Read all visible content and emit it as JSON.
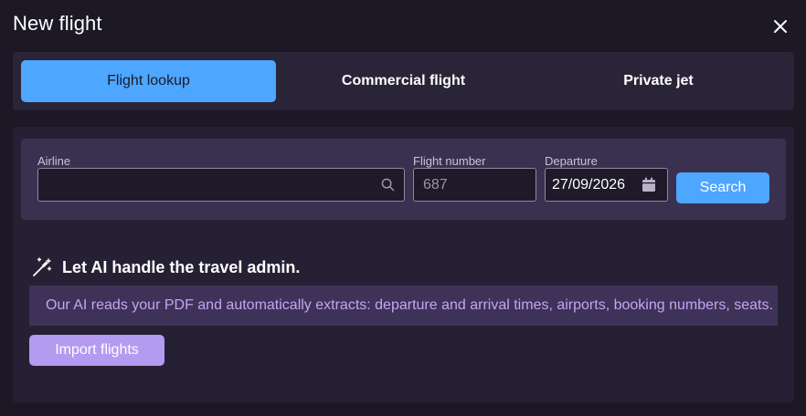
{
  "dialog": {
    "title": "New flight"
  },
  "tabs": [
    {
      "label": "Flight lookup",
      "active": true
    },
    {
      "label": "Commercial flight",
      "active": false
    },
    {
      "label": "Private jet",
      "active": false
    }
  ],
  "lookup": {
    "airline_label": "Airline",
    "airline_value": "",
    "flight_number_label": "Flight number",
    "flight_number_value": "687",
    "departure_label": "Departure",
    "departure_value": "27/09/2026",
    "search_label": "Search"
  },
  "ai": {
    "heading": "Let AI handle the travel admin.",
    "description": "Our AI reads your PDF and automatically extracts: departure and arrival times, airports, booking numbers, seats.",
    "import_label": "Import flights"
  },
  "icons": {
    "close": "close-icon",
    "search": "search-icon",
    "calendar": "calendar-icon",
    "wand": "magic-wand-icon"
  },
  "colors": {
    "accent": "#4da6ff",
    "ai_accent": "#b49af0",
    "ai_text": "#c6a4f4",
    "background": "#1c1826"
  }
}
